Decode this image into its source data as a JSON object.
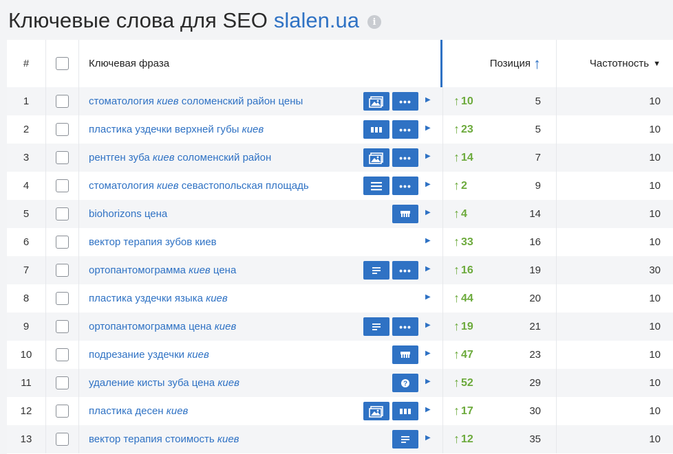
{
  "title": {
    "prefix": "Ключевые слова для SEO",
    "domain": "slalen.ua",
    "info_icon": "i"
  },
  "header": {
    "num": "#",
    "keyword": "Ключевая фраза",
    "position": "Позиция",
    "frequency": "Частотность"
  },
  "colors": {
    "accent": "#2f72c4",
    "up": "#6caa3c"
  },
  "rows": [
    {
      "num": "1",
      "kw": [
        [
          "стоматология ",
          false
        ],
        [
          "киев",
          true
        ],
        [
          " соломенский район цены",
          false
        ]
      ],
      "icons": [
        "image-icon",
        "more-icon"
      ],
      "change": "10",
      "position": "5",
      "frequency": "10"
    },
    {
      "num": "2",
      "kw": [
        [
          "пластика уздечки верхней губы ",
          false
        ],
        [
          "киев",
          true
        ]
      ],
      "icons": [
        "columns-icon",
        "more-icon"
      ],
      "change": "23",
      "position": "5",
      "frequency": "10"
    },
    {
      "num": "3",
      "kw": [
        [
          "рентген зуба ",
          false
        ],
        [
          "киев",
          true
        ],
        [
          " соломенский район",
          false
        ]
      ],
      "icons": [
        "image-icon",
        "more-icon"
      ],
      "change": "14",
      "position": "7",
      "frequency": "10"
    },
    {
      "num": "4",
      "kw": [
        [
          "стоматология ",
          false
        ],
        [
          "киев",
          true
        ],
        [
          " севастопольская площадь",
          false
        ]
      ],
      "icons": [
        "list-icon",
        "more-icon"
      ],
      "change": "2",
      "position": "9",
      "frequency": "10"
    },
    {
      "num": "5",
      "kw": [
        [
          "biohorizons цена",
          false
        ]
      ],
      "icons": [
        "",
        "store-icon"
      ],
      "change": "4",
      "position": "14",
      "frequency": "10"
    },
    {
      "num": "6",
      "kw": [
        [
          "вектор терапия зубов киев",
          false
        ]
      ],
      "icons": [
        "",
        ""
      ],
      "change": "33",
      "position": "16",
      "frequency": "10"
    },
    {
      "num": "7",
      "kw": [
        [
          "ортопантомограмма ",
          false
        ],
        [
          "киев",
          true
        ],
        [
          " цена",
          false
        ]
      ],
      "icons": [
        "text-icon",
        "more-icon"
      ],
      "change": "16",
      "position": "19",
      "frequency": "30"
    },
    {
      "num": "8",
      "kw": [
        [
          "пластика уздечки языка ",
          false
        ],
        [
          "киев",
          true
        ]
      ],
      "icons": [
        "",
        ""
      ],
      "change": "44",
      "position": "20",
      "frequency": "10"
    },
    {
      "num": "9",
      "kw": [
        [
          "ортопантомограмма цена ",
          false
        ],
        [
          "киев",
          true
        ]
      ],
      "icons": [
        "text-icon",
        "more-icon"
      ],
      "change": "19",
      "position": "21",
      "frequency": "10"
    },
    {
      "num": "10",
      "kw": [
        [
          "подрезание уздечки ",
          false
        ],
        [
          "киев",
          true
        ]
      ],
      "icons": [
        "",
        "store-icon"
      ],
      "change": "47",
      "position": "23",
      "frequency": "10"
    },
    {
      "num": "11",
      "kw": [
        [
          "удаление кисты зуба цена ",
          false
        ],
        [
          "киев",
          true
        ]
      ],
      "icons": [
        "",
        "question-icon"
      ],
      "change": "52",
      "position": "29",
      "frequency": "10"
    },
    {
      "num": "12",
      "kw": [
        [
          "пластика десен ",
          false
        ],
        [
          "киев",
          true
        ]
      ],
      "icons": [
        "image-icon",
        "columns-icon"
      ],
      "change": "17",
      "position": "30",
      "frequency": "10"
    },
    {
      "num": "13",
      "kw": [
        [
          "вектор терапия стоимость ",
          false
        ],
        [
          "киев",
          true
        ]
      ],
      "icons": [
        "",
        "text-icon"
      ],
      "change": "12",
      "position": "35",
      "frequency": "10"
    }
  ]
}
